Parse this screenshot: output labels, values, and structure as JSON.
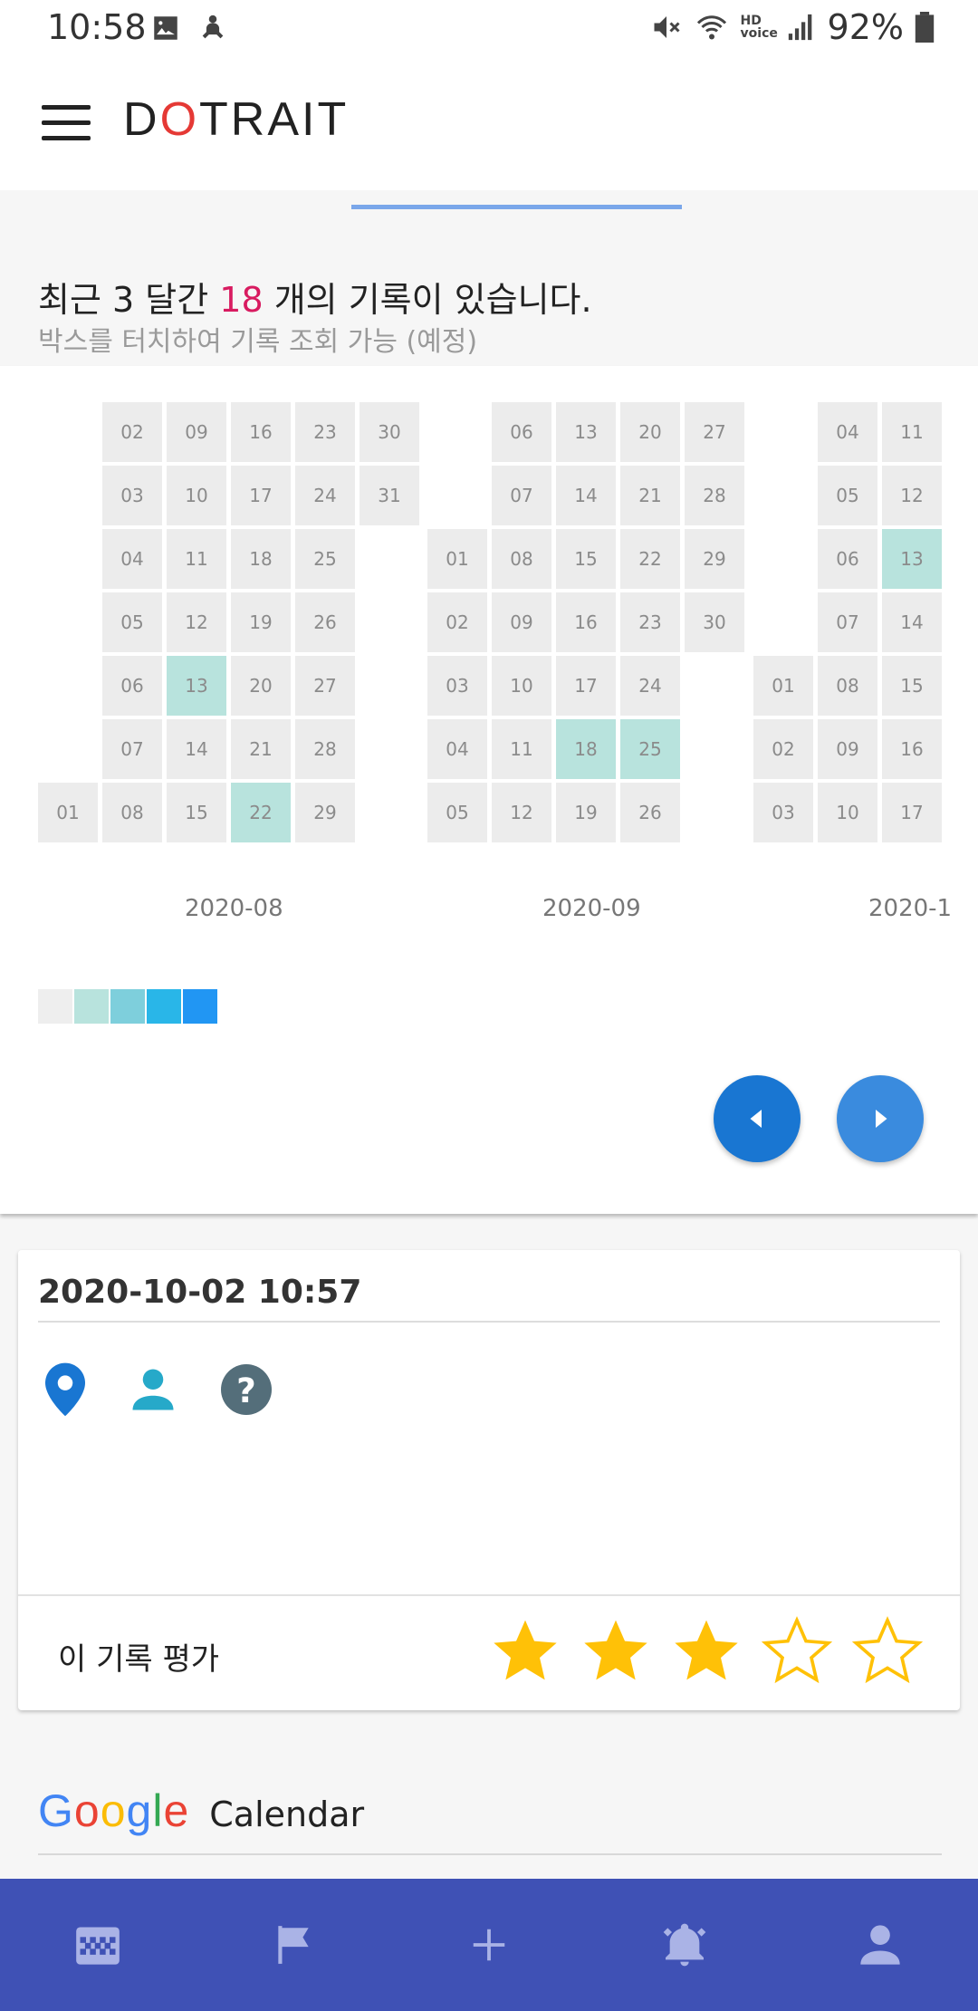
{
  "status_bar": {
    "time": "10:58",
    "battery": "92%",
    "network": "HD voice"
  },
  "app": {
    "title_prefix": "D",
    "title_o": "O",
    "title_suffix": "TRAIT"
  },
  "summary": {
    "prefix": "최근 3 달간 ",
    "count": "18",
    "suffix": " 개의 기록이 있습니다.",
    "hint": "박스를 터치하여 기록 조회 가능 (예정)"
  },
  "calendar": {
    "months": [
      "2020-08",
      "2020-09",
      "2020-1"
    ],
    "highlight_color": "#b8e3dd",
    "empty_color": "#ececec",
    "cells": [
      {
        "label": "01",
        "col": 0,
        "row": 6,
        "level": 0
      },
      {
        "label": "02",
        "col": 1,
        "row": 0,
        "level": 0
      },
      {
        "label": "03",
        "col": 1,
        "row": 1,
        "level": 0
      },
      {
        "label": "04",
        "col": 1,
        "row": 2,
        "level": 0
      },
      {
        "label": "05",
        "col": 1,
        "row": 3,
        "level": 0
      },
      {
        "label": "06",
        "col": 1,
        "row": 4,
        "level": 0
      },
      {
        "label": "07",
        "col": 1,
        "row": 5,
        "level": 0
      },
      {
        "label": "08",
        "col": 1,
        "row": 6,
        "level": 0
      },
      {
        "label": "09",
        "col": 2,
        "row": 0,
        "level": 0
      },
      {
        "label": "10",
        "col": 2,
        "row": 1,
        "level": 0
      },
      {
        "label": "11",
        "col": 2,
        "row": 2,
        "level": 0
      },
      {
        "label": "12",
        "col": 2,
        "row": 3,
        "level": 0
      },
      {
        "label": "13",
        "col": 2,
        "row": 4,
        "level": 1
      },
      {
        "label": "14",
        "col": 2,
        "row": 5,
        "level": 0
      },
      {
        "label": "15",
        "col": 2,
        "row": 6,
        "level": 0
      },
      {
        "label": "16",
        "col": 3,
        "row": 0,
        "level": 0
      },
      {
        "label": "17",
        "col": 3,
        "row": 1,
        "level": 0
      },
      {
        "label": "18",
        "col": 3,
        "row": 2,
        "level": 0
      },
      {
        "label": "19",
        "col": 3,
        "row": 3,
        "level": 0
      },
      {
        "label": "20",
        "col": 3,
        "row": 4,
        "level": 0
      },
      {
        "label": "21",
        "col": 3,
        "row": 5,
        "level": 0
      },
      {
        "label": "22",
        "col": 3,
        "row": 6,
        "level": 1
      },
      {
        "label": "23",
        "col": 4,
        "row": 0,
        "level": 0
      },
      {
        "label": "24",
        "col": 4,
        "row": 1,
        "level": 0
      },
      {
        "label": "25",
        "col": 4,
        "row": 2,
        "level": 0
      },
      {
        "label": "26",
        "col": 4,
        "row": 3,
        "level": 0
      },
      {
        "label": "27",
        "col": 4,
        "row": 4,
        "level": 0
      },
      {
        "label": "28",
        "col": 4,
        "row": 5,
        "level": 0
      },
      {
        "label": "29",
        "col": 4,
        "row": 6,
        "level": 0
      },
      {
        "label": "30",
        "col": 5,
        "row": 0,
        "level": 0
      },
      {
        "label": "31",
        "col": 5,
        "row": 1,
        "level": 0
      },
      {
        "label": "01",
        "col": 6,
        "row": 2,
        "level": 0
      },
      {
        "label": "02",
        "col": 6,
        "row": 3,
        "level": 0
      },
      {
        "label": "03",
        "col": 6,
        "row": 4,
        "level": 0
      },
      {
        "label": "04",
        "col": 6,
        "row": 5,
        "level": 0
      },
      {
        "label": "05",
        "col": 6,
        "row": 6,
        "level": 0
      },
      {
        "label": "06",
        "col": 7,
        "row": 0,
        "level": 0
      },
      {
        "label": "07",
        "col": 7,
        "row": 1,
        "level": 0
      },
      {
        "label": "08",
        "col": 7,
        "row": 2,
        "level": 0
      },
      {
        "label": "09",
        "col": 7,
        "row": 3,
        "level": 0
      },
      {
        "label": "10",
        "col": 7,
        "row": 4,
        "level": 0
      },
      {
        "label": "11",
        "col": 7,
        "row": 5,
        "level": 0
      },
      {
        "label": "12",
        "col": 7,
        "row": 6,
        "level": 0
      },
      {
        "label": "13",
        "col": 8,
        "row": 0,
        "level": 0
      },
      {
        "label": "14",
        "col": 8,
        "row": 1,
        "level": 0
      },
      {
        "label": "15",
        "col": 8,
        "row": 2,
        "level": 0
      },
      {
        "label": "16",
        "col": 8,
        "row": 3,
        "level": 0
      },
      {
        "label": "17",
        "col": 8,
        "row": 4,
        "level": 0
      },
      {
        "label": "18",
        "col": 8,
        "row": 5,
        "level": 1
      },
      {
        "label": "19",
        "col": 8,
        "row": 6,
        "level": 0
      },
      {
        "label": "20",
        "col": 9,
        "row": 0,
        "level": 0
      },
      {
        "label": "21",
        "col": 9,
        "row": 1,
        "level": 0
      },
      {
        "label": "22",
        "col": 9,
        "row": 2,
        "level": 0
      },
      {
        "label": "23",
        "col": 9,
        "row": 3,
        "level": 0
      },
      {
        "label": "24",
        "col": 9,
        "row": 4,
        "level": 0
      },
      {
        "label": "25",
        "col": 9,
        "row": 5,
        "level": 1
      },
      {
        "label": "26",
        "col": 9,
        "row": 6,
        "level": 0
      },
      {
        "label": "27",
        "col": 10,
        "row": 0,
        "level": 0
      },
      {
        "label": "28",
        "col": 10,
        "row": 1,
        "level": 0
      },
      {
        "label": "29",
        "col": 10,
        "row": 2,
        "level": 0
      },
      {
        "label": "30",
        "col": 10,
        "row": 3,
        "level": 0
      },
      {
        "label": "01",
        "col": 11,
        "row": 4,
        "level": 0
      },
      {
        "label": "02",
        "col": 11,
        "row": 5,
        "level": 0
      },
      {
        "label": "03",
        "col": 11,
        "row": 6,
        "level": 0
      },
      {
        "label": "04",
        "col": 12,
        "row": 0,
        "level": 0
      },
      {
        "label": "05",
        "col": 12,
        "row": 1,
        "level": 0
      },
      {
        "label": "06",
        "col": 12,
        "row": 2,
        "level": 0
      },
      {
        "label": "07",
        "col": 12,
        "row": 3,
        "level": 0
      },
      {
        "label": "08",
        "col": 12,
        "row": 4,
        "level": 0
      },
      {
        "label": "09",
        "col": 12,
        "row": 5,
        "level": 0
      },
      {
        "label": "10",
        "col": 12,
        "row": 6,
        "level": 0
      },
      {
        "label": "11",
        "col": 13,
        "row": 0,
        "level": 0
      },
      {
        "label": "12",
        "col": 13,
        "row": 1,
        "level": 0
      },
      {
        "label": "13",
        "col": 13,
        "row": 2,
        "level": 1
      },
      {
        "label": "14",
        "col": 13,
        "row": 3,
        "level": 0
      },
      {
        "label": "15",
        "col": 13,
        "row": 4,
        "level": 0
      },
      {
        "label": "16",
        "col": 13,
        "row": 5,
        "level": 0
      },
      {
        "label": "17",
        "col": 13,
        "row": 6,
        "level": 0
      }
    ],
    "legend_colors": [
      "#eeeeee",
      "#b8e3dd",
      "#7ecfdc",
      "#29b6e8",
      "#2196f3"
    ],
    "prev_label": "previous",
    "next_label": "next"
  },
  "record": {
    "datetime": "2020-10-02 10:57",
    "icons": [
      "location-pin-icon",
      "person-icon",
      "help-icon"
    ],
    "rating_label": "이 기록 평가",
    "rating": 3,
    "rating_max": 5,
    "star_color": "#ffc107"
  },
  "google_calendar": {
    "logo_letters": [
      {
        "ch": "G",
        "color": "#4285f4"
      },
      {
        "ch": "o",
        "color": "#ea4335"
      },
      {
        "ch": "o",
        "color": "#fbbc05"
      },
      {
        "ch": "g",
        "color": "#4285f4"
      },
      {
        "ch": "l",
        "color": "#34a853"
      },
      {
        "ch": "e",
        "color": "#ea4335"
      }
    ],
    "label": "Calendar"
  },
  "bottom_nav": {
    "background": "#3f51b5",
    "items": [
      "calendar-grid-icon",
      "flag-icon",
      "add-icon",
      "alarm-bell-icon",
      "account-icon"
    ]
  }
}
